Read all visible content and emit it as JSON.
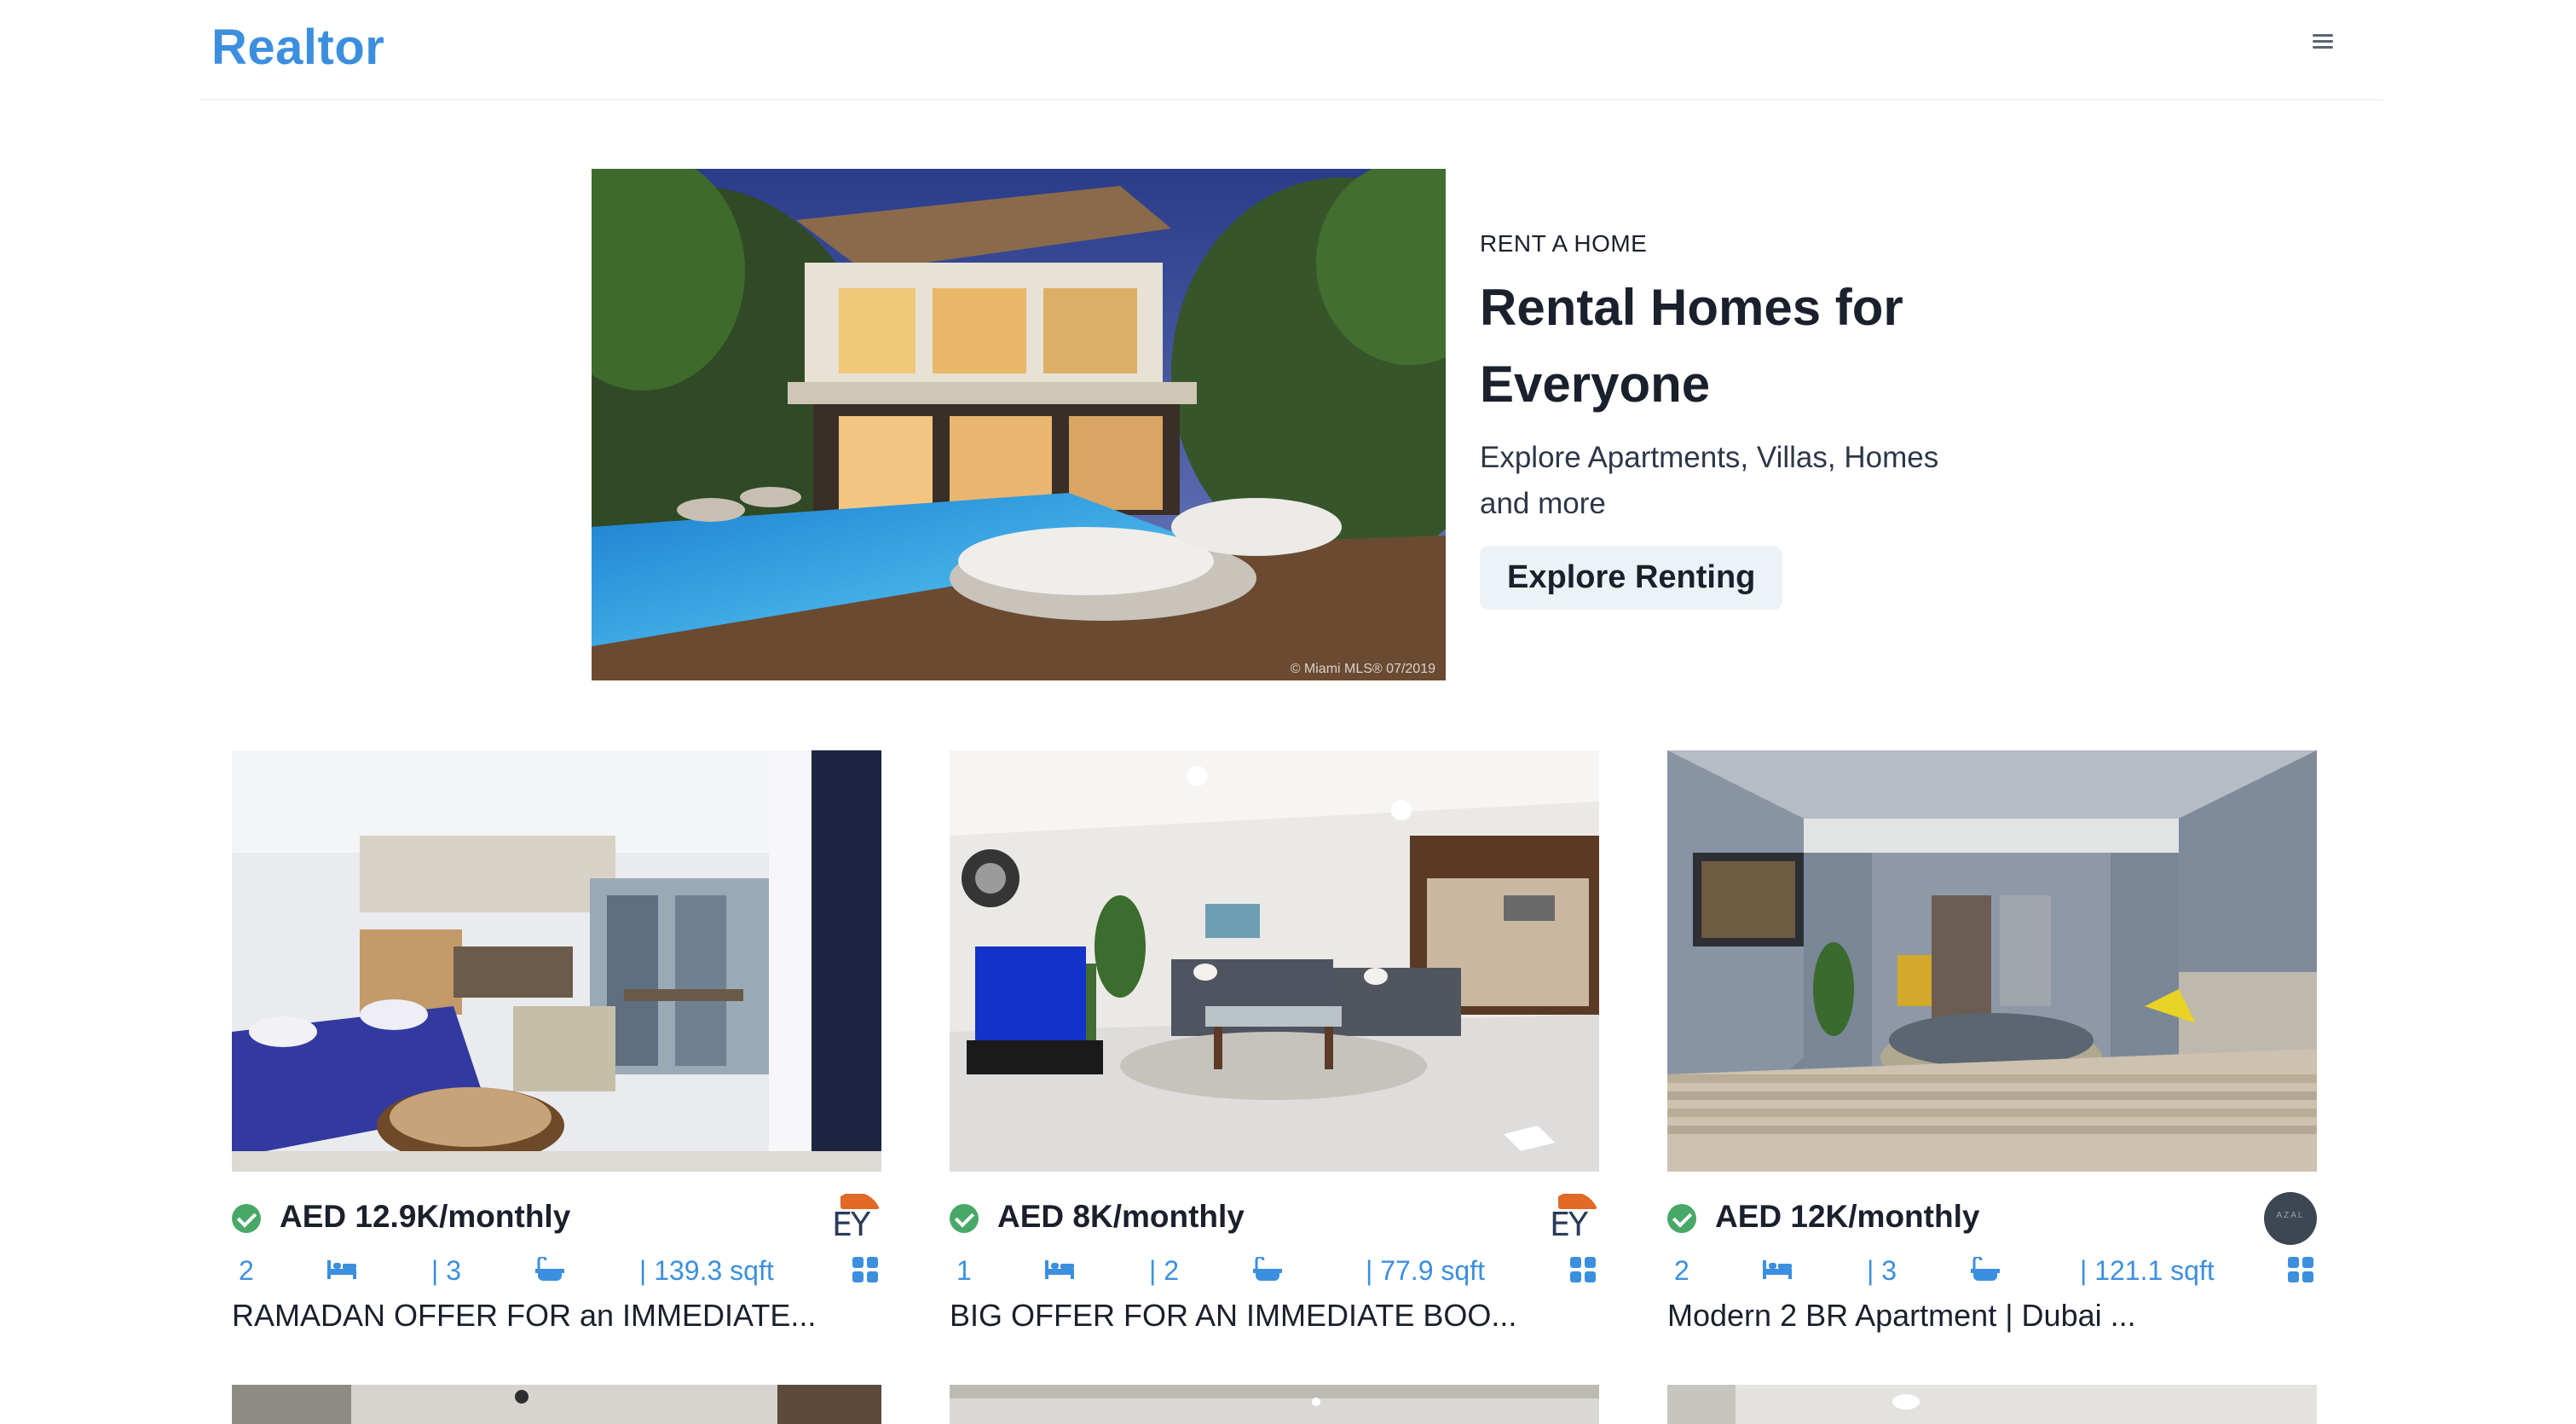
{
  "nav": {
    "logo": "Realtor",
    "menu_icon": "hamburger-menu-icon"
  },
  "hero": {
    "image_caption": "© Miami MLS® 07/2019",
    "kicker": "RENT A HOME",
    "title": "Rental Homes for Everyone",
    "description": "Explore Apartments, Villas, Homes and more",
    "button": "Explore Renting"
  },
  "cards": [
    {
      "price": "AED 12.9K/monthly",
      "rooms": "2",
      "baths": "| 3",
      "area": "| 139.3 sqft",
      "title": "RAMADAN OFFER FOR an IMMEDIATE...",
      "agency_logo": "EY"
    },
    {
      "price": "AED 8K/monthly",
      "rooms": "1",
      "baths": "| 2",
      "area": "| 77.9 sqft",
      "title": "BIG OFFER FOR AN IMMEDIATE BOO...",
      "agency_logo": "EY"
    },
    {
      "price": "AED 12K/monthly",
      "rooms": "2",
      "baths": "| 3",
      "area": "| 121.1 sqft",
      "title": "Modern 2 BR Apartment | Dubai ...",
      "agency_logo": "AZAL"
    }
  ],
  "icons": {
    "verified": "verified-check-icon",
    "bed": "bed-icon",
    "bath": "bath-icon",
    "area": "grid-icon"
  },
  "colors": {
    "brand": "#3c8fde",
    "verified": "#48a868",
    "button_bg": "#edf2f7"
  }
}
